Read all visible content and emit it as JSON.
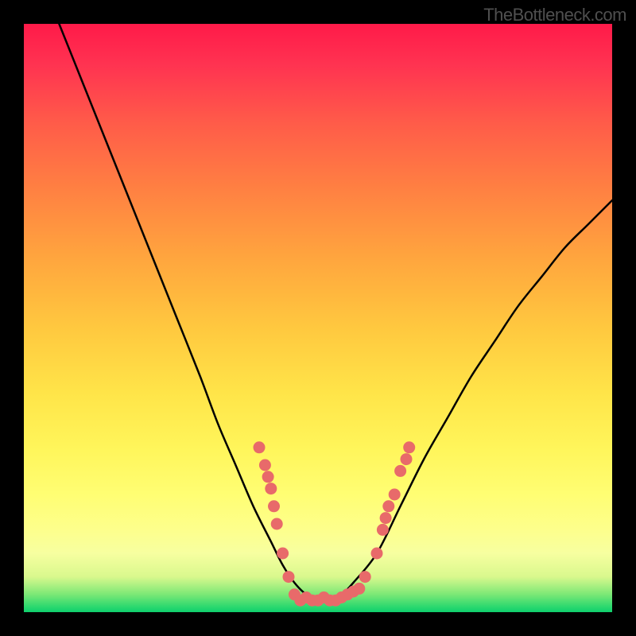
{
  "watermark": "TheBottleneck.com",
  "chart_data": {
    "type": "line",
    "title": "",
    "xlabel": "",
    "ylabel": "",
    "xlim": [
      0,
      100
    ],
    "ylim": [
      0,
      100
    ],
    "series": [
      {
        "name": "curve",
        "x": [
          6,
          10,
          14,
          18,
          22,
          26,
          30,
          33,
          36,
          39,
          42,
          44,
          46,
          48,
          50,
          52,
          54,
          56,
          60,
          64,
          68,
          72,
          76,
          80,
          84,
          88,
          92,
          96,
          100
        ],
        "y": [
          100,
          90,
          80,
          70,
          60,
          50,
          40,
          32,
          25,
          18,
          12,
          8,
          5,
          3,
          2,
          2,
          3,
          5,
          10,
          18,
          26,
          33,
          40,
          46,
          52,
          57,
          62,
          66,
          70
        ]
      }
    ],
    "markers_left": {
      "name": "dots-left",
      "x": [
        40,
        41,
        41.5,
        42,
        42.5,
        43,
        44,
        45
      ],
      "y": [
        28,
        25,
        23,
        21,
        18,
        15,
        10,
        6
      ]
    },
    "markers_right": {
      "name": "dots-right",
      "x": [
        58,
        60,
        61,
        61.5,
        62,
        63,
        64,
        65,
        65.5
      ],
      "y": [
        6,
        10,
        14,
        16,
        18,
        20,
        24,
        26,
        28
      ]
    },
    "markers_bottom": {
      "name": "dots-bottom",
      "x": [
        46,
        47,
        48,
        49,
        50,
        51,
        52,
        53,
        54,
        55,
        56,
        57
      ],
      "y": [
        3,
        2,
        2.5,
        2,
        2,
        2.5,
        2,
        2,
        2.5,
        3,
        3.5,
        4
      ]
    },
    "marker_color": "#e86a6a",
    "curve_color": "#000000"
  }
}
